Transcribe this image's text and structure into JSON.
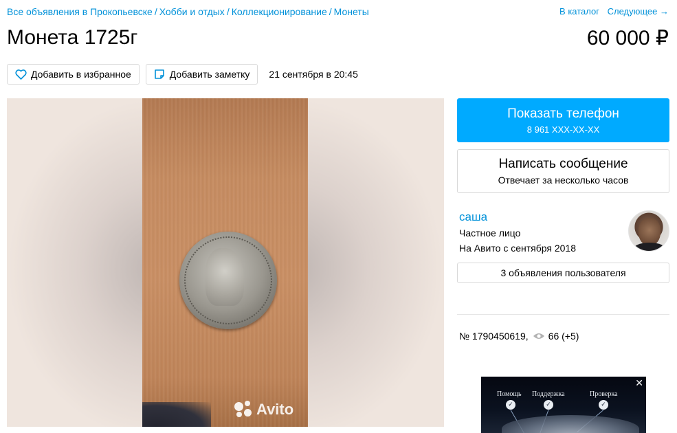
{
  "breadcrumbs": [
    "Все объявления в Прокопьевске",
    "Хобби и отдых",
    "Коллекционирование",
    "Монеты"
  ],
  "topnav": {
    "catalog": "В каталог",
    "next": "Следующее →"
  },
  "listing": {
    "title": "Монета 1725г",
    "price": "60 000 ₽",
    "date": "21 сентября в 20:45",
    "number": "№ 1790450619,",
    "views": "66 (+5)"
  },
  "actions": {
    "favorite": "Добавить в избранное",
    "note": "Добавить заметку"
  },
  "gallery": {
    "watermark": "Avito"
  },
  "contact": {
    "phone_label": "Показать телефон",
    "phone_number": "8 961 XXX-XX-XX",
    "message_label": "Написать сообщение",
    "message_sub": "Отвечает за несколько часов"
  },
  "seller": {
    "name": "саша",
    "type": "Частное лицо",
    "since": "На Авито с сентября 2018",
    "ads_label": "3 объявления пользователя"
  },
  "banner": {
    "items": [
      "Помощь",
      "Поддержка",
      "Проверка"
    ],
    "close": "✕"
  },
  "colors": {
    "accent": "#00aaff",
    "link": "#0091d9"
  }
}
